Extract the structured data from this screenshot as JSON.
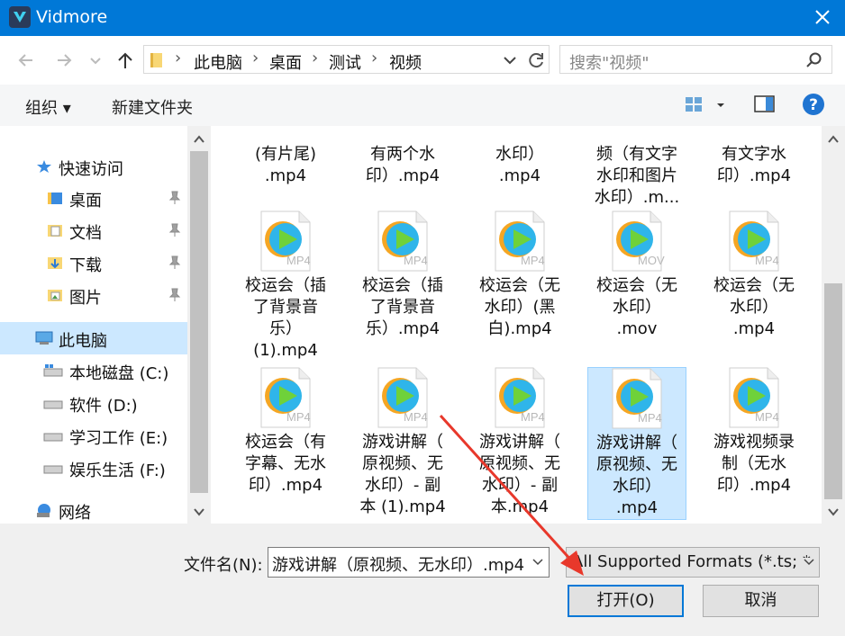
{
  "window": {
    "title": "Vidmore"
  },
  "address": {
    "crumbs": [
      "此电脑",
      "桌面",
      "测试",
      "视频"
    ]
  },
  "search": {
    "placeholder": "搜索\"视频\""
  },
  "toolbar": {
    "organize": "组织 ▾",
    "new_folder": "新建文件夹"
  },
  "sidebar": {
    "quick_access": "快速访问",
    "items": [
      "桌面",
      "文档",
      "下载",
      "图片"
    ],
    "this_pc": "此电脑",
    "drives": [
      "本地磁盘 (C:)",
      "软件 (D:)",
      "学习工作 (E:)",
      "娱乐生活 (F:)"
    ],
    "network": "网络"
  },
  "files_top_row": [
    [
      "(有片尾)",
      ".mp4"
    ],
    [
      "有两个水",
      "印）.mp4"
    ],
    [
      "水印）",
      ".mp4"
    ],
    [
      "频（有文字",
      "水印和图片",
      "水印）.m..."
    ],
    [
      "有文字水",
      "印）.mp4"
    ]
  ],
  "files": [
    {
      "badge": "MP4",
      "lines": [
        "校运会（插",
        "了背景音",
        "乐）",
        "(1).mp4"
      ]
    },
    {
      "badge": "MP4",
      "lines": [
        "校运会（插",
        "了背景音",
        "乐）.mp4"
      ]
    },
    {
      "badge": "MP4",
      "lines": [
        "校运会（无",
        "水印）(黑",
        "白).mp4"
      ]
    },
    {
      "badge": "MOV",
      "lines": [
        "校运会（无",
        "水印）",
        ".mov"
      ]
    },
    {
      "badge": "MP4",
      "lines": [
        "校运会（无",
        "水印）",
        ".mp4"
      ]
    },
    {
      "badge": "MP4",
      "lines": [
        "校运会（有",
        "字幕、无水",
        "印）.mp4"
      ]
    },
    {
      "badge": "MP4",
      "lines": [
        "游戏讲解（",
        "原视频、无",
        "水印）- 副",
        "本 (1).mp4"
      ]
    },
    {
      "badge": "MP4",
      "lines": [
        "游戏讲解（",
        "原视频、无",
        "水印）- 副",
        "本.mp4"
      ]
    },
    {
      "badge": "MP4",
      "lines": [
        "游戏讲解（",
        "原视频、无",
        "水印）",
        ".mp4"
      ],
      "selected": true
    },
    {
      "badge": "MP4",
      "lines": [
        "游戏视频录",
        "制（无水",
        "印）.mp4"
      ]
    }
  ],
  "bottom": {
    "filename_label": "文件名(N):",
    "filename_value": "游戏讲解（原视频、无水印）.mp4",
    "filter_value": "All Supported Formats (*.ts; *",
    "open_label": "打开(O)",
    "cancel_label": "取消"
  },
  "colors": {
    "title_bar": "#0078d7",
    "selection": "#cce8ff",
    "arrow": "#e8382b"
  }
}
